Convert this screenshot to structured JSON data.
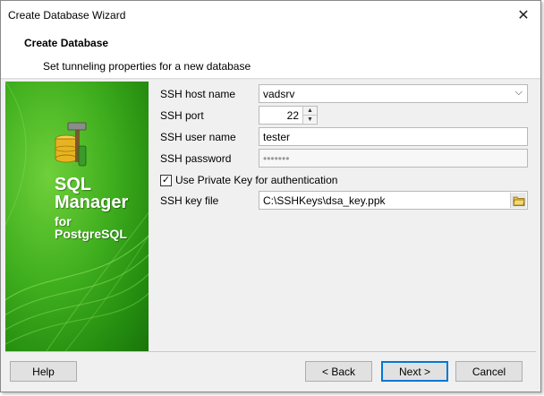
{
  "window": {
    "title": "Create Database Wizard"
  },
  "header": {
    "title": "Create Database",
    "subtitle": "Set tunneling properties for a new database"
  },
  "banner": {
    "product_line1": "SQL",
    "product_line2": "Manager",
    "product_line3": "for",
    "product_line4": "PostgreSQL",
    "accent_color": "#3fae1e"
  },
  "form": {
    "ssh_host_label": "SSH host name",
    "ssh_host_value": "vadsrv",
    "ssh_port_label": "SSH port",
    "ssh_port_value": "22",
    "ssh_user_label": "SSH user name",
    "ssh_user_value": "tester",
    "ssh_password_label": "SSH password",
    "ssh_password_value": "•••••••",
    "use_private_key_label": "Use Private Key for authentication",
    "use_private_key_checked": true,
    "ssh_key_label": "SSH key file",
    "ssh_key_value": "C:\\SSHKeys\\dsa_key.ppk"
  },
  "footer": {
    "help_label": "Help",
    "back_label": "< Back",
    "next_label": "Next >",
    "cancel_label": "Cancel"
  }
}
